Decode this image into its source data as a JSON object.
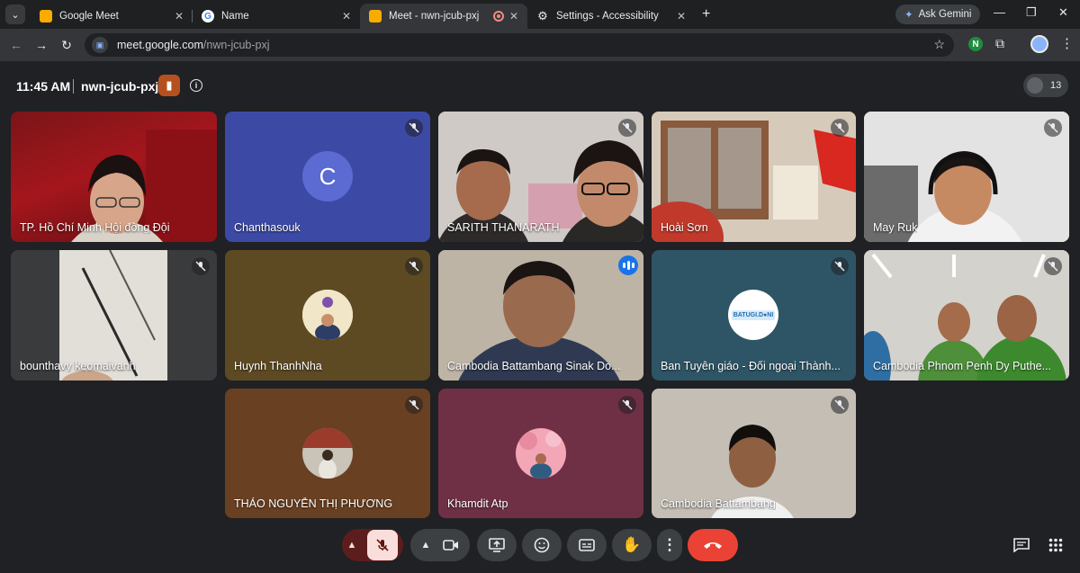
{
  "browser": {
    "tabs": [
      {
        "title": "Google Meet",
        "favicon": "meet-icon"
      },
      {
        "title": "Name",
        "favicon": "google-icon"
      },
      {
        "title": "Meet - nwn-jcub-pxj",
        "favicon": "meet-icon"
      },
      {
        "title": "Settings - Accessibility",
        "favicon": "gear-icon"
      }
    ],
    "gemini_label": "Ask Gemini",
    "url": {
      "host": "meet.google.com",
      "path": "/nwn-jcub-pxj"
    },
    "extension_badge": "N"
  },
  "meeting": {
    "time": "11:45 AM",
    "code": "nwn-jcub-pxj",
    "participant_count": "13"
  },
  "tiles": [
    {
      "name": "TP. Hồ Chí Minh Hội đồng Đội",
      "muted": false
    },
    {
      "name": "Chanthasouk",
      "muted": true,
      "avatar_letter": "C",
      "bg": "#3c4aa6"
    },
    {
      "name": "SARITH THANARATH",
      "muted": true
    },
    {
      "name": "Hoài Sơn",
      "muted": true
    },
    {
      "name": "May Ruk",
      "muted": true
    },
    {
      "name": "bounthavy keomaivanh",
      "muted": true
    },
    {
      "name": "Huynh ThanhNha",
      "muted": true,
      "bg": "#5d4a23"
    },
    {
      "name": "Cambodia Battambang Sinak Do...",
      "muted": false,
      "speaking": true
    },
    {
      "name": "Ban Tuyên giáo - Đối ngoại Thành...",
      "muted": true,
      "avatar_text": "BATUGI.D●NI",
      "bg": "#2e5566"
    },
    {
      "name": "Cambodia Phnom Penh Dy Puthe...",
      "muted": true
    },
    {
      "name": "THẢO NGUYỄN THỊ PHƯƠNG",
      "muted": true,
      "bg": "#6a4022"
    },
    {
      "name": "Khamdit Atp",
      "muted": true,
      "bg": "#6f3045"
    },
    {
      "name": "Cambodia Battambang",
      "muted": true
    }
  ],
  "colors": {
    "accent": "#1a73e8",
    "danger": "#ea4335",
    "mic_off_bg": "#f9dedc"
  }
}
